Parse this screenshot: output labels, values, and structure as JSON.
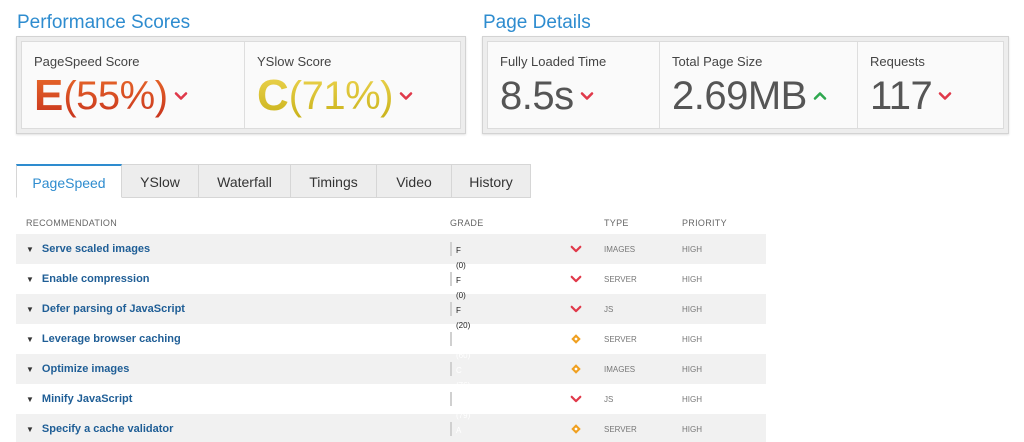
{
  "performance": {
    "title": "Performance Scores",
    "pagespeed": {
      "label": "PageSpeed Score",
      "grade": "E",
      "percent": "(55%)",
      "trend": "down"
    },
    "yslow": {
      "label": "YSlow Score",
      "grade": "C",
      "percent": "(71%)",
      "trend": "down"
    }
  },
  "details": {
    "title": "Page Details",
    "loaded": {
      "label": "Fully Loaded Time",
      "value": "8.5s",
      "trend": "down"
    },
    "size": {
      "label": "Total Page Size",
      "value": "2.69MB",
      "trend": "up"
    },
    "requests": {
      "label": "Requests",
      "value": "117",
      "trend": "down"
    }
  },
  "tabs": [
    {
      "label": "PageSpeed",
      "active": true
    },
    {
      "label": "YSlow"
    },
    {
      "label": "Waterfall"
    },
    {
      "label": "Timings"
    },
    {
      "label": "Video"
    },
    {
      "label": "History"
    }
  ],
  "table": {
    "headers": {
      "recommendation": "RECOMMENDATION",
      "grade": "GRADE",
      "type": "TYPE",
      "priority": "PRIORITY"
    },
    "rows": [
      {
        "name": "Serve scaled images",
        "grade": "F (0)",
        "score": 0,
        "type": "IMAGES",
        "priority": "HIGH",
        "trend": "down"
      },
      {
        "name": "Enable compression",
        "grade": "F (0)",
        "score": 0,
        "type": "SERVER",
        "priority": "HIGH",
        "trend": "down"
      },
      {
        "name": "Defer parsing of JavaScript",
        "grade": "F (20)",
        "score": 20,
        "type": "JS",
        "priority": "HIGH",
        "trend": "down"
      },
      {
        "name": "Leverage browser caching",
        "grade": "D (60)",
        "score": 60,
        "type": "SERVER",
        "priority": "HIGH",
        "trend": "neutral"
      },
      {
        "name": "Optimize images",
        "grade": "C (76)",
        "score": 76,
        "type": "IMAGES",
        "priority": "HIGH",
        "trend": "neutral"
      },
      {
        "name": "Minify JavaScript",
        "grade": "C (79)",
        "score": 79,
        "type": "JS",
        "priority": "HIGH",
        "trend": "down"
      },
      {
        "name": "Specify a cache validator",
        "grade": "A (90)",
        "score": 90,
        "type": "SERVER",
        "priority": "HIGH",
        "trend": "neutral"
      }
    ]
  },
  "colors": {
    "accent": "#2e8ccf",
    "down": "#e0394a",
    "up": "#2fa84f",
    "neutral": "#f0a020",
    "gradeE_top": "#e86a2a",
    "gradeE_bottom": "#c8331d",
    "gradeC_top": "#ecd34e",
    "gradeC_bottom": "#c9b21a",
    "gradeA": "#36a82e",
    "gradeC": "#cdbb0c",
    "gradeD": "#e3961f",
    "gradeF": "#e43a33"
  }
}
